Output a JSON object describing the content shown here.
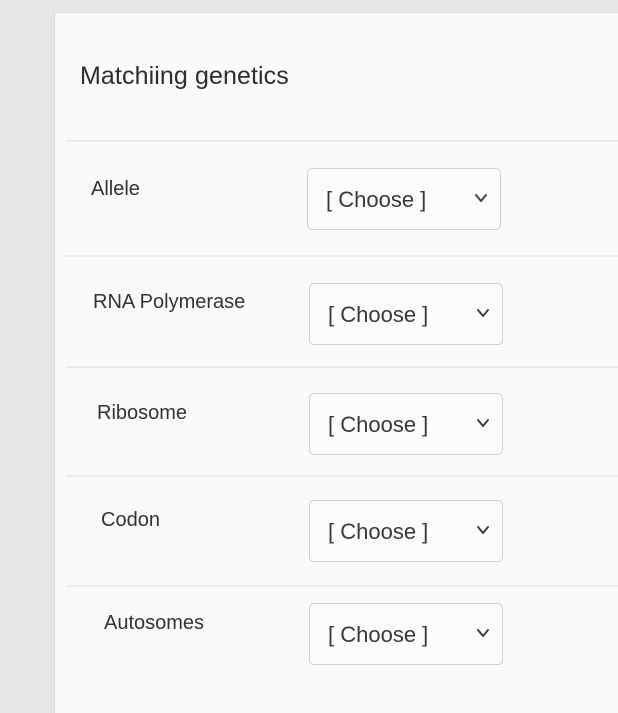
{
  "quiz": {
    "title": "Matchiing genetics",
    "select_placeholder": "[ Choose ]",
    "rows": [
      {
        "term": "Allele",
        "selected": "[ Choose ]",
        "icon": "chevron-down-icon"
      },
      {
        "term": "RNA Polymerase",
        "selected": "[ Choose ]",
        "icon": "chevron-down-icon"
      },
      {
        "term": "Ribosome",
        "selected": "[ Choose ]",
        "icon": "chevron-down-icon"
      },
      {
        "term": "Codon",
        "selected": "[ Choose ]",
        "icon": "chevron-down-icon"
      },
      {
        "term": "Autosomes",
        "selected": "[ Choose ]",
        "icon": "chevron-down-icon"
      }
    ]
  }
}
